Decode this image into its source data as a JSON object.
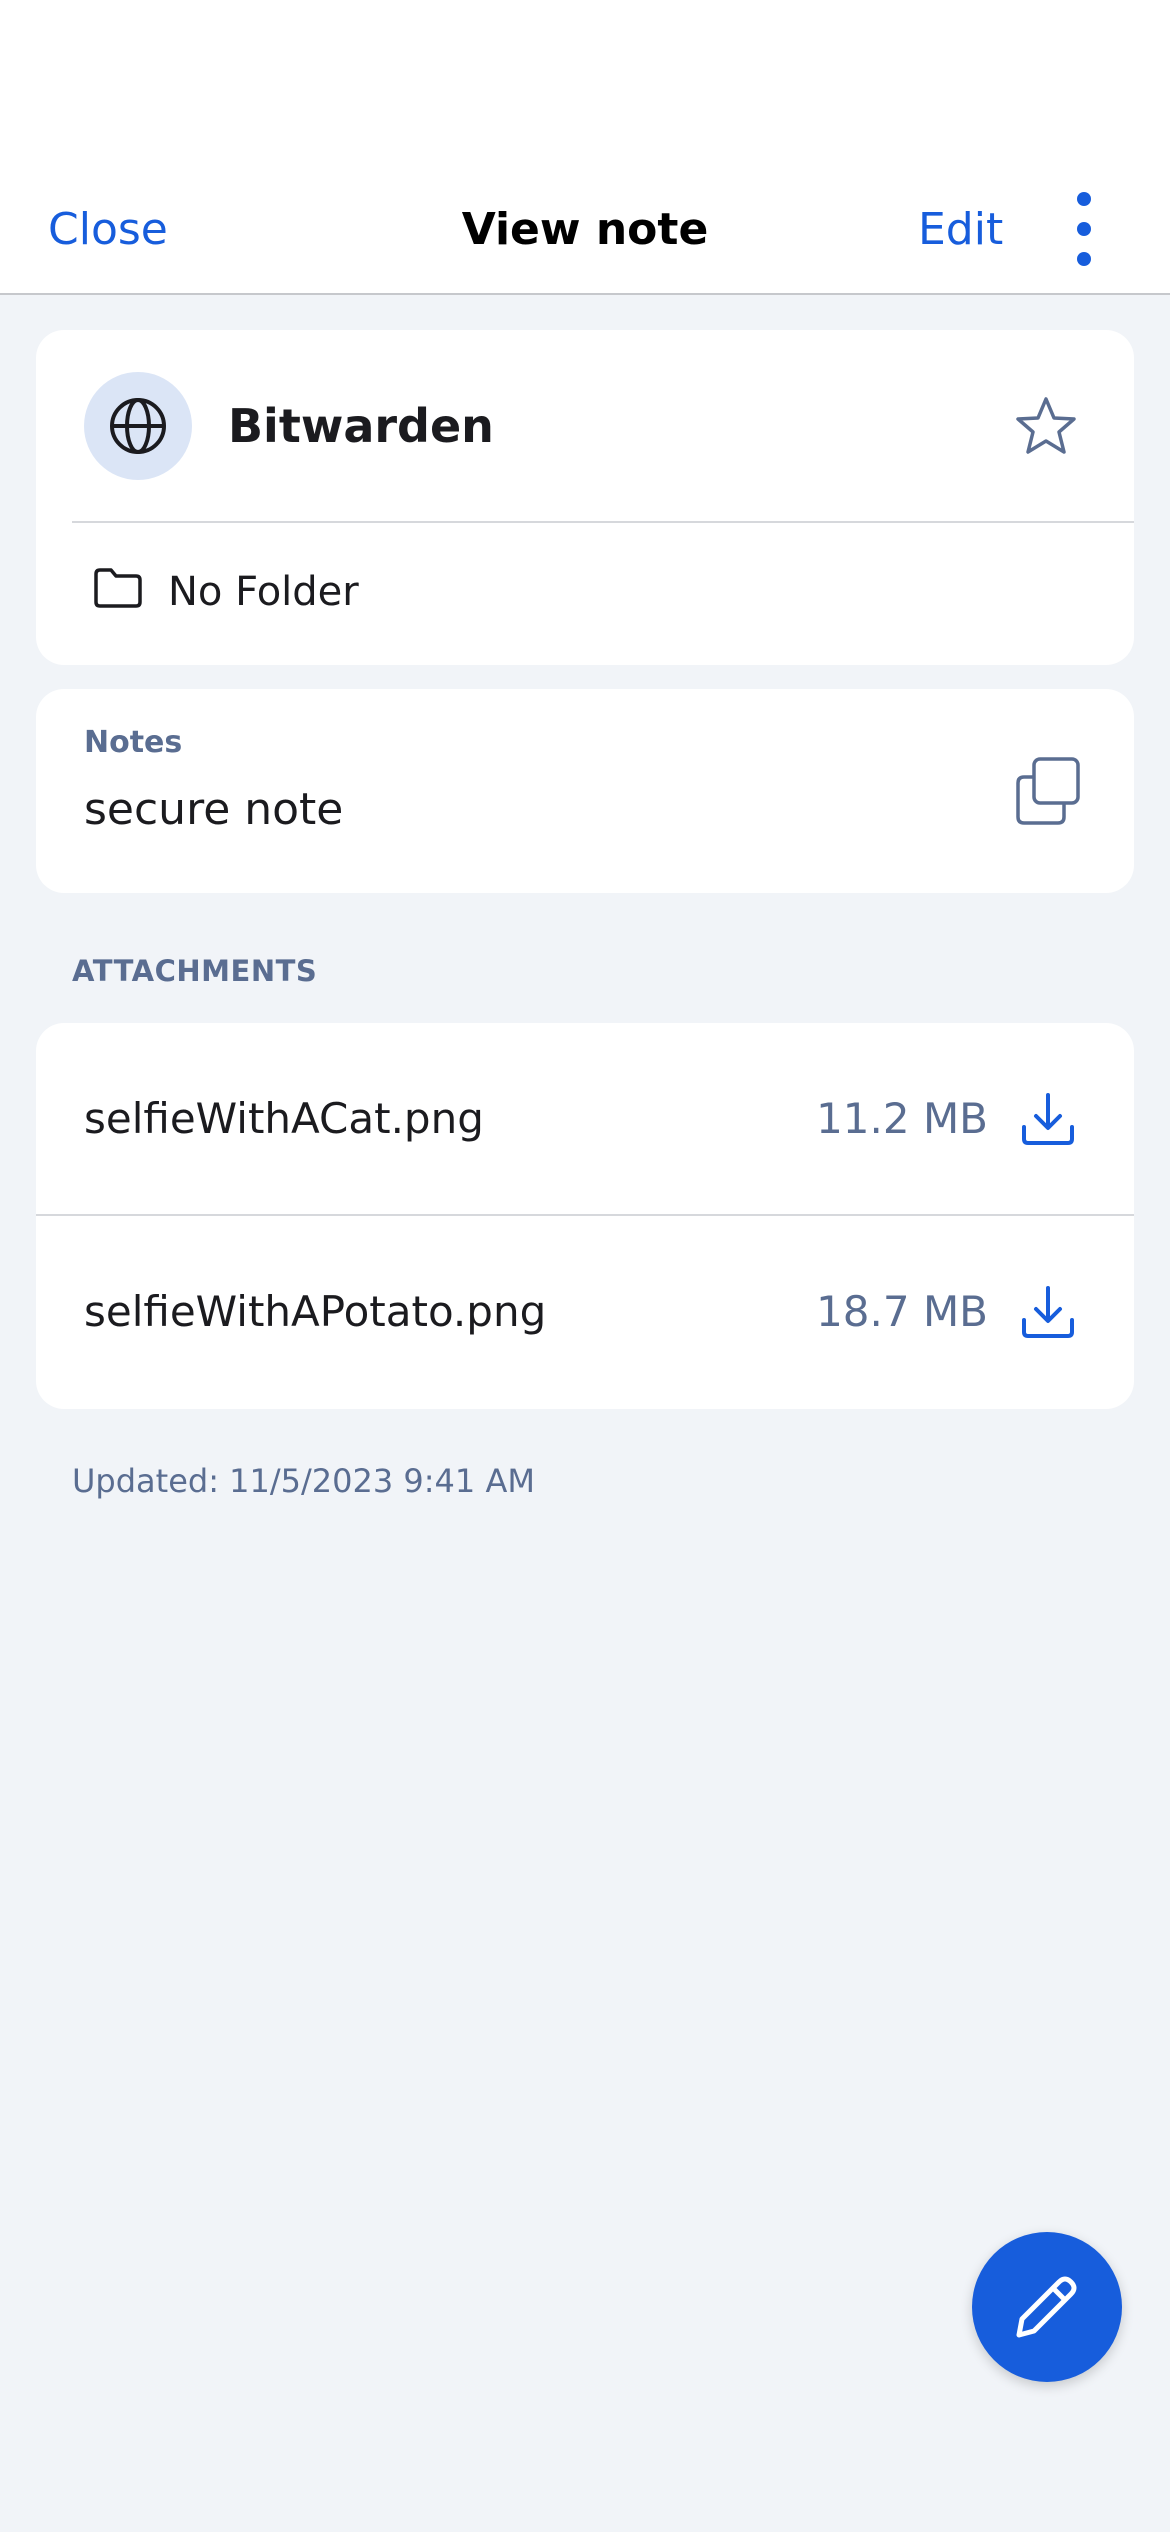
{
  "nav": {
    "close_label": "Close",
    "title": "View note",
    "edit_label": "Edit"
  },
  "item": {
    "name": "Bitwarden",
    "icon": "globe-icon",
    "folder": "No Folder"
  },
  "notes": {
    "label": "Notes",
    "value": "secure note"
  },
  "attachments": {
    "section_title": "ATTACHMENTS",
    "items": [
      {
        "name": "selfieWithACat.png",
        "size": "11.2 MB"
      },
      {
        "name": "selfieWithAPotato.png",
        "size": "18.7 MB"
      }
    ]
  },
  "updated": "Updated: 11/5/2023 9:41 AM",
  "colors": {
    "accent": "#175ddc",
    "background": "#f1f4f8",
    "muted_text": "#5a6d91"
  }
}
